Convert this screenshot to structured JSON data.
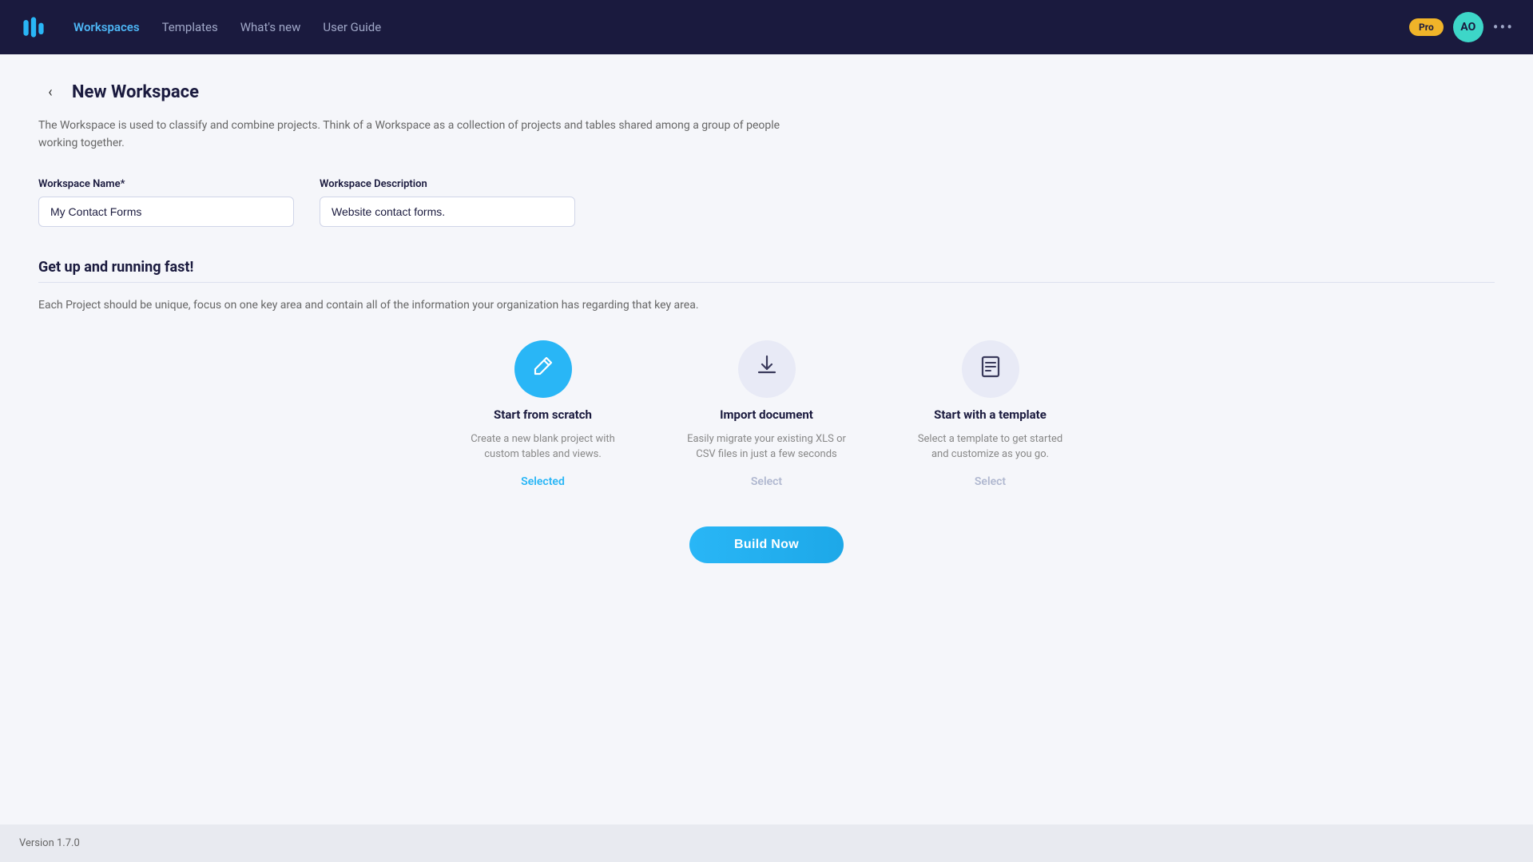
{
  "header": {
    "logo_alt": "Workbase logo",
    "nav": [
      {
        "label": "Workspaces",
        "active": true
      },
      {
        "label": "Templates",
        "active": false
      },
      {
        "label": "What's new",
        "active": false
      },
      {
        "label": "User Guide",
        "active": false
      }
    ],
    "pro_label": "Pro",
    "avatar_initials": "AO",
    "more_icon": "•••"
  },
  "page": {
    "back_icon": "‹",
    "title": "New Workspace",
    "description": "The Workspace is used to classify and combine projects. Think of a Workspace as a collection of projects and tables shared among a group of people working together."
  },
  "form": {
    "name_label": "Workspace Name*",
    "name_value": "My Contact Forms",
    "name_placeholder": "My Contact Forms",
    "desc_label": "Workspace Description",
    "desc_value": "Website contact forms.",
    "desc_placeholder": "Website contact forms."
  },
  "section": {
    "title": "Get up and running fast!",
    "subtitle": "Each Project should be unique, focus on one key area and contain all of the information your organization has regarding that key area."
  },
  "options": [
    {
      "id": "scratch",
      "icon": "✏️",
      "icon_unicode": "✎",
      "title": "Start from scratch",
      "desc": "Create a new blank project with custom tables and views.",
      "select_label": "Selected",
      "selected": true
    },
    {
      "id": "import",
      "icon": "⬆",
      "icon_unicode": "⬆",
      "title": "Import document",
      "desc": "Easily migrate your existing XLS or CSV files in just a few seconds",
      "select_label": "Select",
      "selected": false
    },
    {
      "id": "template",
      "icon": "📋",
      "icon_unicode": "▤",
      "title": "Start with a template",
      "desc": "Select a template to get started and customize as you go.",
      "select_label": "Select",
      "selected": false
    }
  ],
  "build_button": "Build Now",
  "footer": {
    "version": "Version 1.7.0"
  }
}
